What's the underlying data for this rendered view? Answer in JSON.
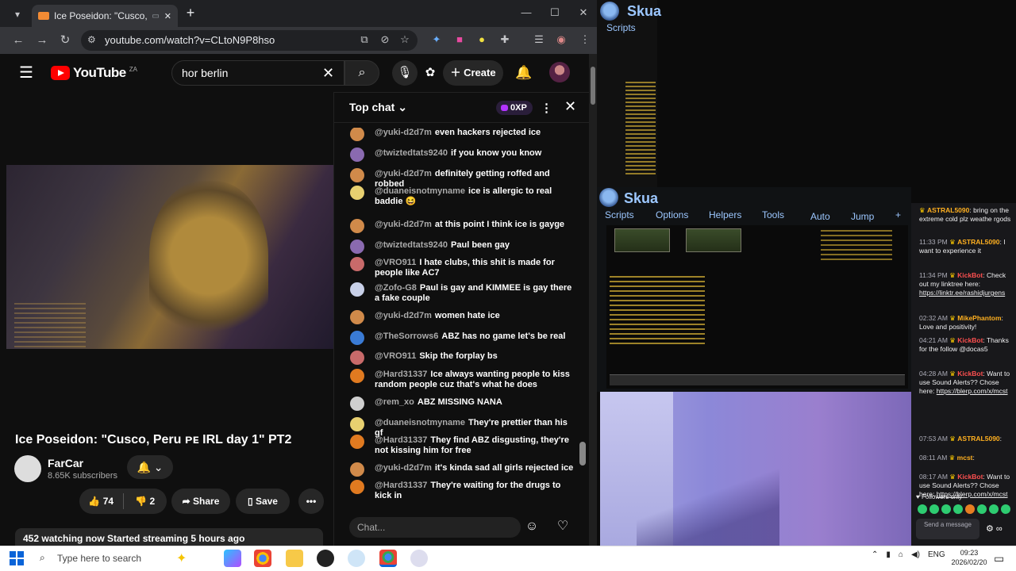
{
  "browser": {
    "tab_title": "Ice Poseidon: \"Cusco, Peru",
    "tab_menu_icon": "chevron-down-icon",
    "new_tab_icon": "+",
    "window_controls": {
      "minimize": "—",
      "maximize": "☐",
      "close": "✕"
    },
    "url": "youtube.com/watch?v=CLtoN9P8hso",
    "nav": {
      "back": "←",
      "forward": "→",
      "reload": "↻"
    }
  },
  "youtube": {
    "logo_text": "YouTube",
    "country_code": "ZA",
    "search_value": "hor berlin",
    "create_label": "Create",
    "video_title": "Ice Poseidon: \"Cusco, Peru ᴘᴇ IRL day 1\" PT2",
    "channel_name": "FarCar",
    "subscribers": "8.65K subscribers",
    "likes": "74",
    "dislikes": "2",
    "share_label": "Share",
    "save_label": "Save",
    "live_info": "452 watching now  Started streaming 5 hours ago"
  },
  "chat": {
    "mode_label": "Top chat",
    "xp_label": "0XP",
    "input_placeholder": "Chat...",
    "messages": [
      {
        "user": "@yuki-d2d7m",
        "text": "even hackers rejected ice",
        "color": "#d08a4a"
      },
      {
        "user": "@twiztedtats9240",
        "text": "if you know you know",
        "color": "#8a6ab0"
      },
      {
        "user": "@yuki-d2d7m",
        "text": "definitely getting roffed and robbed",
        "color": "#d08a4a"
      },
      {
        "user": "@duaneisnotmyname",
        "text": "ice is allergic to real baddie 😆",
        "color": "#e8d070"
      },
      {
        "user": "@yuki-d2d7m",
        "text": "at this point I think ice is gayge",
        "color": "#d08a4a"
      },
      {
        "user": "@twiztedtats9240",
        "text": "Paul been gay",
        "color": "#8a6ab0"
      },
      {
        "user": "@VRO911",
        "text": "I hate clubs, this shit is made for people like AC7",
        "color": "#c86a6a"
      },
      {
        "user": "@Zofo-G8",
        "text": "Paul is gay and KIMMEE is gay there a fake couple",
        "color": "#c8d0e8"
      },
      {
        "user": "@yuki-d2d7m",
        "text": "women hate ice",
        "color": "#d08a4a"
      },
      {
        "user": "@TheSorrows6",
        "text": "ABZ has no game let's be real",
        "color": "#3a7bd5"
      },
      {
        "user": "@VRO911",
        "text": "Skip the forplay bs",
        "color": "#c86a6a"
      },
      {
        "user": "@Hard31337",
        "text": "Ice always wanting people to kiss random people cuz that's what he does",
        "color": "#e07a20"
      },
      {
        "user": "@rem_xo",
        "text": "ABZ MISSING NANA",
        "color": "#cfcfcf"
      },
      {
        "user": "@duaneisnotmyname",
        "text": "They're prettier than his gf",
        "color": "#e8d070"
      },
      {
        "user": "@Hard31337",
        "text": "They find ABZ disgusting, they're not kissing him for free",
        "color": "#e07a20"
      },
      {
        "user": "@yuki-d2d7m",
        "text": "it's kinda sad all girls rejected ice",
        "color": "#d08a4a"
      },
      {
        "user": "@Hard31337",
        "text": "They're waiting for the drugs to kick in",
        "color": "#e07a20"
      }
    ]
  },
  "skua": {
    "title": "Skua",
    "scripts_label": "Scripts",
    "menu": [
      "Scripts",
      "Options",
      "Helpers",
      "Tools",
      "Auto",
      "Jump",
      "+"
    ]
  },
  "twitch": {
    "messages": [
      {
        "time": "",
        "name": "ASTRAL5090",
        "name_color": "#ffb020",
        "text": ": bring on the extreme cold plz weathe rgods"
      },
      {
        "time": "11:33 PM",
        "name": "ASTRAL5090",
        "name_color": "#ffb020",
        "text": ": I want to experience it"
      },
      {
        "time": "11:34 PM",
        "name": "KickBot",
        "name_color": "#ff5050",
        "text": ": Check out my linktree here: ",
        "link": "https://linktr.ee/rashidjurgens"
      },
      {
        "time": "02:32 AM",
        "name": "MikePhantom",
        "name_color": "#ffb020",
        "text": ": Love and positivity!"
      },
      {
        "time": "04:21 AM",
        "name": "KickBot",
        "name_color": "#ff5050",
        "text": ": Thanks for the follow @docas5"
      },
      {
        "time": "04:28 AM",
        "name": "KickBot",
        "name_color": "#ff5050",
        "text": ": Want to use Sound Alerts?? Chose here: ",
        "link": "https://blerp.com/x/mcst"
      },
      {
        "time": "07:53 AM",
        "name": "ASTRAL5090",
        "name_color": "#ffb020",
        "text": ":"
      },
      {
        "time": "08:11 AM",
        "name": "mcst",
        "name_color": "#ffb020",
        "text": ":"
      },
      {
        "time": "08:17 AM",
        "name": "KickBot",
        "name_color": "#ff5050",
        "text": ": Want to use Sound Alerts?? Chose here: ",
        "link": "https://blerp.com/x/mcst"
      }
    ],
    "followers_only": "Followers only",
    "send_placeholder": "Send a message"
  },
  "taskbar": {
    "search_placeholder": "Type here to search",
    "language": "ENG",
    "time": "09:23",
    "date": "2026/02/20"
  }
}
